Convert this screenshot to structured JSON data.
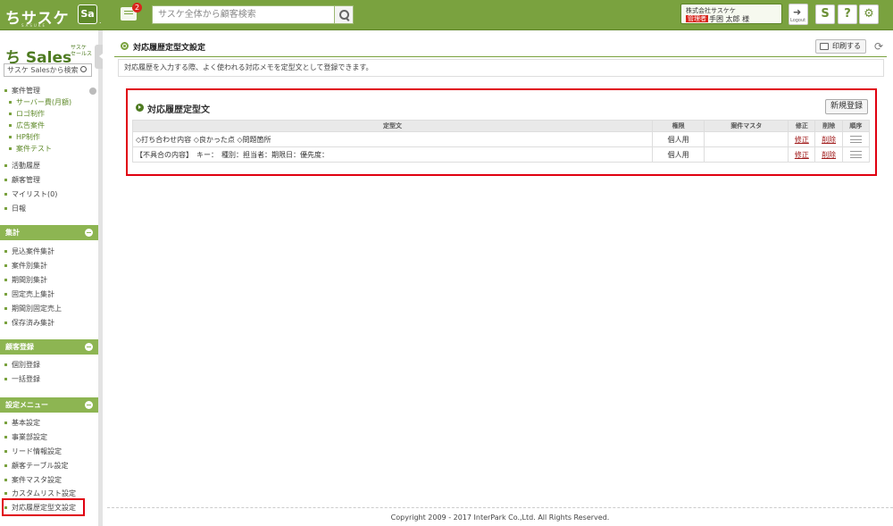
{
  "topbar": {
    "logo": "ちサスケ",
    "logo_sub": "SASUKE",
    "sa_button": "Sa",
    "notification_count": "2",
    "search_placeholder": "サスケ全体から顧客検索",
    "company": "株式会社サスケケ",
    "role_badge": "管理者",
    "user_name": "手困 太郎 様",
    "logout_label": "Logout",
    "icons": [
      "chat-icon",
      "search-icon",
      "logout-icon",
      "sasuke-icon",
      "help-icon",
      "settings-icon"
    ],
    "accent_color": "#7aa23f"
  },
  "sidebar": {
    "logo": "ち Sales",
    "logo_sub1": "サスケ",
    "logo_sub2": "セールス",
    "search_placeholder": "サスケ Salesから検索",
    "items": [
      {
        "label": "案件管理",
        "sub": false
      },
      {
        "label": "サーバー費(月額)",
        "sub": true
      },
      {
        "label": "ロゴ制作",
        "sub": true
      },
      {
        "label": "広告案件",
        "sub": true
      },
      {
        "label": "HP制作",
        "sub": true
      },
      {
        "label": "案件テスト",
        "sub": true
      },
      {
        "label": "活動履歴",
        "sub": false
      },
      {
        "label": "顧客管理",
        "sub": false
      },
      {
        "label": "マイリスト(0)",
        "sub": false
      },
      {
        "label": "日報",
        "sub": false
      }
    ],
    "sections": [
      {
        "title": "集計",
        "items": [
          "見込案件集計",
          "案件別集計",
          "期間別集計",
          "固定売上集計",
          "期間別固定売上",
          "保存済み集計"
        ]
      },
      {
        "title": "顧客登録",
        "items": [
          "個別登録",
          "一括登録"
        ]
      },
      {
        "title": "設定メニュー",
        "items": [
          "基本設定",
          "事業部設定",
          "リード情報設定",
          "顧客テーブル設定",
          "案件マスタ設定",
          "カスタムリスト設定",
          "対応履歴定型文設定"
        ]
      }
    ]
  },
  "main": {
    "title": "対応履歴定型文設定",
    "print_label": "印刷する",
    "description": "対応履歴を入力する際、よく使われる対応メモを定型文として登録できます。",
    "panel": {
      "title": "対応履歴定型文",
      "new_button": "新規登録",
      "columns": [
        "定型文",
        "権限",
        "案件マスタ",
        "修正",
        "削除",
        "順序"
      ],
      "rows": [
        {
          "text": "◇打ち合わせ内容 ◇良かった点 ◇問題箇所",
          "permission": "個人用",
          "master": "",
          "edit": "修正",
          "delete": "削除"
        },
        {
          "text": "【不具合の内容】　キー：　種別：担当者：期限日：優先度：",
          "permission": "個人用",
          "master": "",
          "edit": "修正",
          "delete": "削除"
        }
      ]
    }
  },
  "footer": "Copyright 2009 - 2017 InterPark Co.,Ltd. All Rights Reserved."
}
